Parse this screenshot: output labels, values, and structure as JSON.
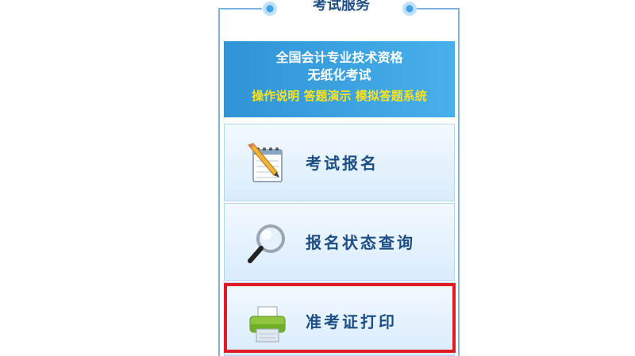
{
  "header": {
    "title": "考试服务"
  },
  "banner": {
    "line1": "全国会计专业技术资格",
    "line2": "无纸化考试",
    "links": [
      "操作说明",
      "答题演示",
      "模拟答题系统"
    ]
  },
  "items": [
    {
      "label": "考试报名",
      "icon": "notepad-pencil-icon"
    },
    {
      "label": "报名状态查询",
      "icon": "magnifier-icon"
    },
    {
      "label": "准考证打印",
      "icon": "printer-icon"
    }
  ],
  "colors": {
    "frame": "#7fb4e0",
    "banner_bg": "#2f93d4",
    "banner_link": "#ffe21a",
    "label_text": "#1d4f86",
    "highlight": "#e21b23"
  }
}
